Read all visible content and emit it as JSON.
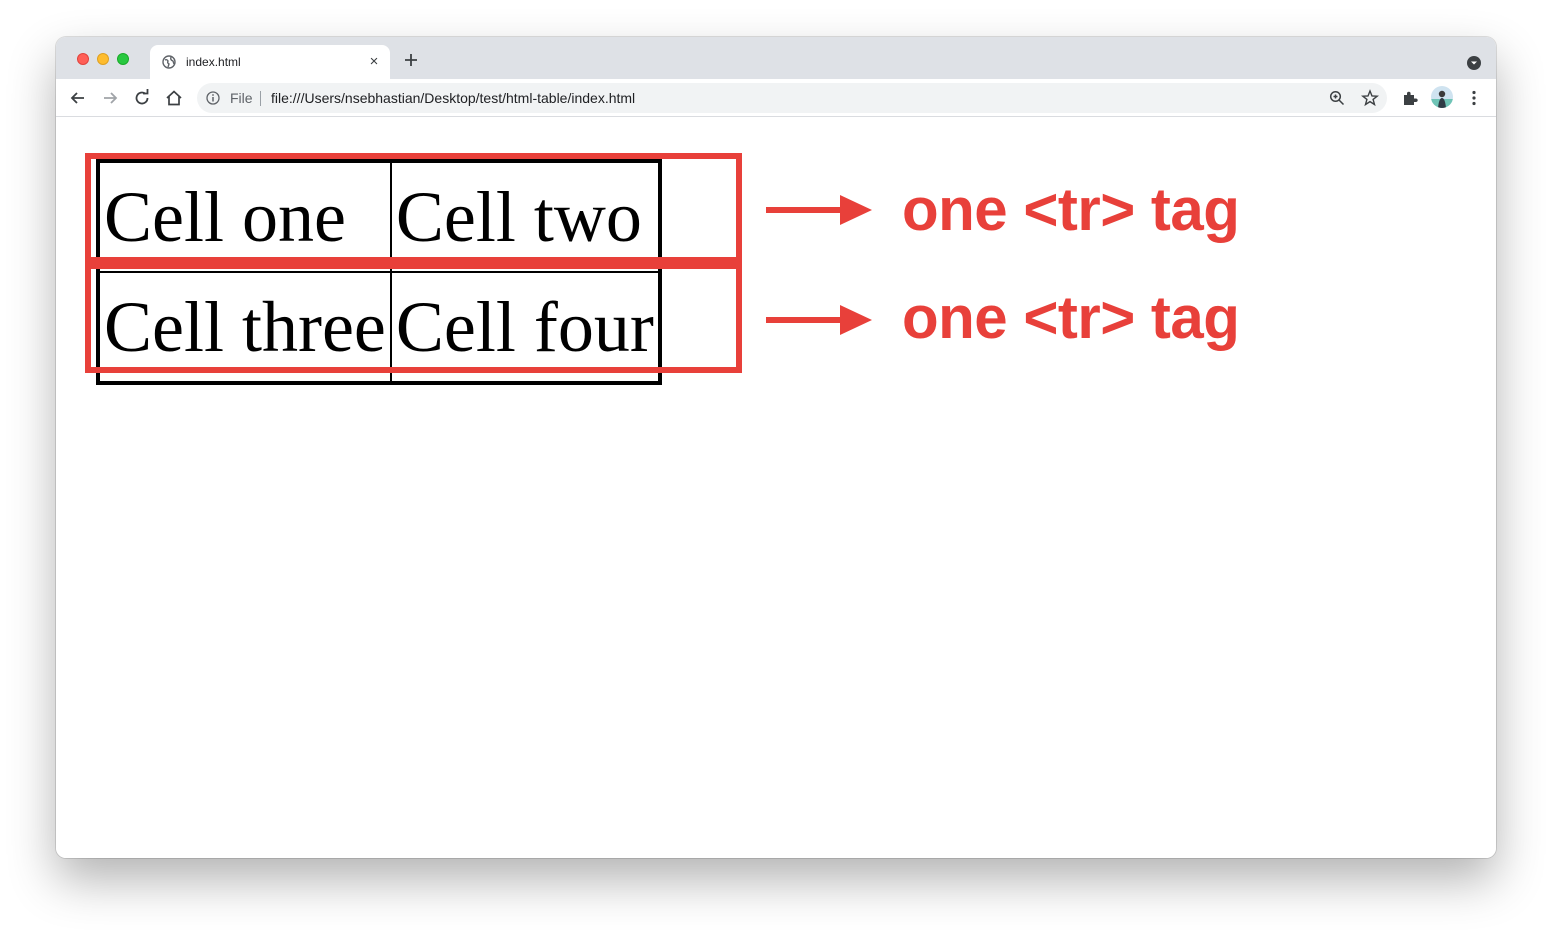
{
  "browser": {
    "tab": {
      "title": "index.html",
      "close_glyph": "×",
      "favicon": "globe-icon"
    },
    "toolbar": {
      "scheme_label": "File",
      "url": "file:///Users/nsebhastian/Desktop/test/html-table/index.html",
      "icons": [
        "back-arrow-icon",
        "forward-arrow-icon",
        "reload-icon",
        "home-icon",
        "info-icon",
        "zoom-icon",
        "star-icon",
        "puzzle-icon",
        "kebab-menu-icon"
      ]
    },
    "colors": {
      "tabstrip": "#dee1e6",
      "annotation": "#e8403a"
    }
  },
  "page": {
    "table": {
      "rows": [
        [
          "Cell one",
          "Cell two"
        ],
        [
          "Cell three",
          "Cell four"
        ]
      ]
    },
    "annotations": [
      {
        "label": "one <tr> tag"
      },
      {
        "label": "one <tr> tag"
      }
    ]
  }
}
